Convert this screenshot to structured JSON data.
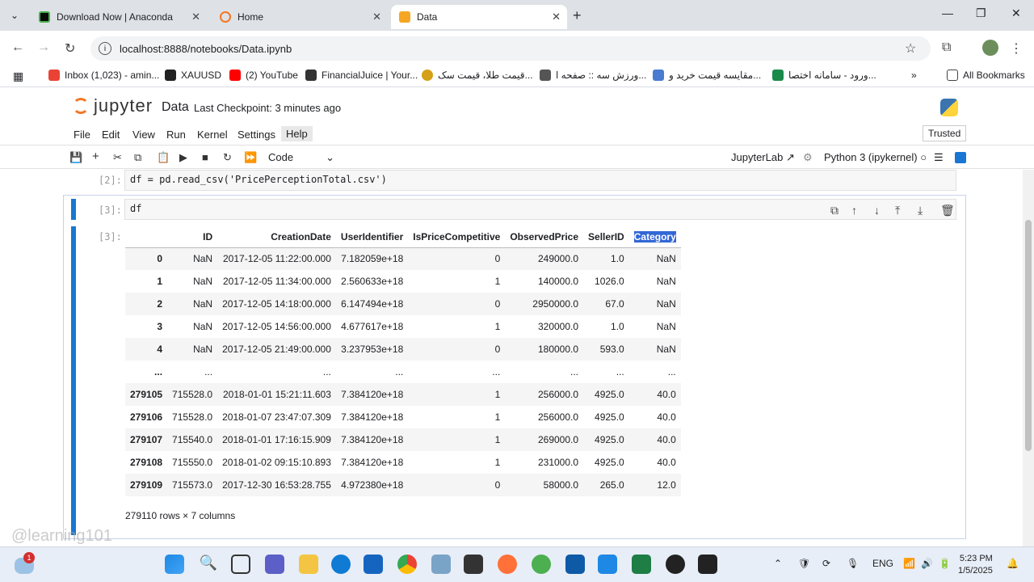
{
  "browser": {
    "tabs": [
      {
        "label": "Download Now | Anaconda"
      },
      {
        "label": "Home"
      },
      {
        "label": "Data"
      }
    ],
    "url": "localhost:8888/notebooks/Data.ipynb",
    "bookmarks": [
      "Inbox (1,023) - amin...",
      "XAUUSD",
      "(2) YouTube",
      "FinancialJuice | Your...",
      "قیمت طلا، قیمت سک...",
      "ورزش سه :: صفحه ا...",
      "مقایسه قیمت خرید و...",
      "ورود - سامانه اختصا..."
    ],
    "all_bookmarks": "All Bookmarks"
  },
  "jupyter": {
    "logo": "jupyter",
    "notebook_name": "Data",
    "checkpoint": "Last Checkpoint: 3 minutes ago",
    "menu": [
      "File",
      "Edit",
      "View",
      "Run",
      "Kernel",
      "Settings",
      "Help"
    ],
    "trusted": "Trusted",
    "cell_type": "Code",
    "jupyterlab_label": "JupyterLab",
    "kernel_label": "Python 3 (ipykernel)"
  },
  "cells": {
    "c2_prompt": "[2]:",
    "c2_code": "df = pd.read_csv('PricePerceptionTotal.csv')",
    "c3_prompt": "[3]:",
    "c3_code": "df",
    "c3_out_prompt": "[3]:"
  },
  "dataframe": {
    "columns": [
      "ID",
      "CreationDate",
      "UserIdentifier",
      "IsPriceCompetitive",
      "ObservedPrice",
      "SellerID",
      "Category"
    ],
    "rows": [
      [
        "0",
        "NaN",
        "2017-12-05 11:22:00.000",
        "7.182059e+18",
        "0",
        "249000.0",
        "1.0",
        "NaN"
      ],
      [
        "1",
        "NaN",
        "2017-12-05 11:34:00.000",
        "2.560633e+18",
        "1",
        "140000.0",
        "1026.0",
        "NaN"
      ],
      [
        "2",
        "NaN",
        "2017-12-05 14:18:00.000",
        "6.147494e+18",
        "0",
        "2950000.0",
        "67.0",
        "NaN"
      ],
      [
        "3",
        "NaN",
        "2017-12-05 14:56:00.000",
        "4.677617e+18",
        "1",
        "320000.0",
        "1.0",
        "NaN"
      ],
      [
        "4",
        "NaN",
        "2017-12-05 21:49:00.000",
        "3.237953e+18",
        "0",
        "180000.0",
        "593.0",
        "NaN"
      ],
      [
        "...",
        "...",
        "...",
        "...",
        "...",
        "...",
        "...",
        "..."
      ],
      [
        "279105",
        "715528.0",
        "2018-01-01 15:21:11.603",
        "7.384120e+18",
        "1",
        "256000.0",
        "4925.0",
        "40.0"
      ],
      [
        "279106",
        "715528.0",
        "2018-01-07 23:47:07.309",
        "7.384120e+18",
        "1",
        "256000.0",
        "4925.0",
        "40.0"
      ],
      [
        "279107",
        "715540.0",
        "2018-01-01 17:16:15.909",
        "7.384120e+18",
        "1",
        "269000.0",
        "4925.0",
        "40.0"
      ],
      [
        "279108",
        "715550.0",
        "2018-01-02 09:15:10.893",
        "7.384120e+18",
        "1",
        "231000.0",
        "4925.0",
        "40.0"
      ],
      [
        "279109",
        "715573.0",
        "2017-12-30 16:53:28.755",
        "4.972380e+18",
        "0",
        "58000.0",
        "265.0",
        "12.0"
      ]
    ],
    "shape": "279110 rows × 7 columns"
  },
  "watermark": "@learning101",
  "taskbar": {
    "lang": "ENG",
    "time": "5:23 PM",
    "date": "1/5/2025",
    "badge": "1"
  }
}
